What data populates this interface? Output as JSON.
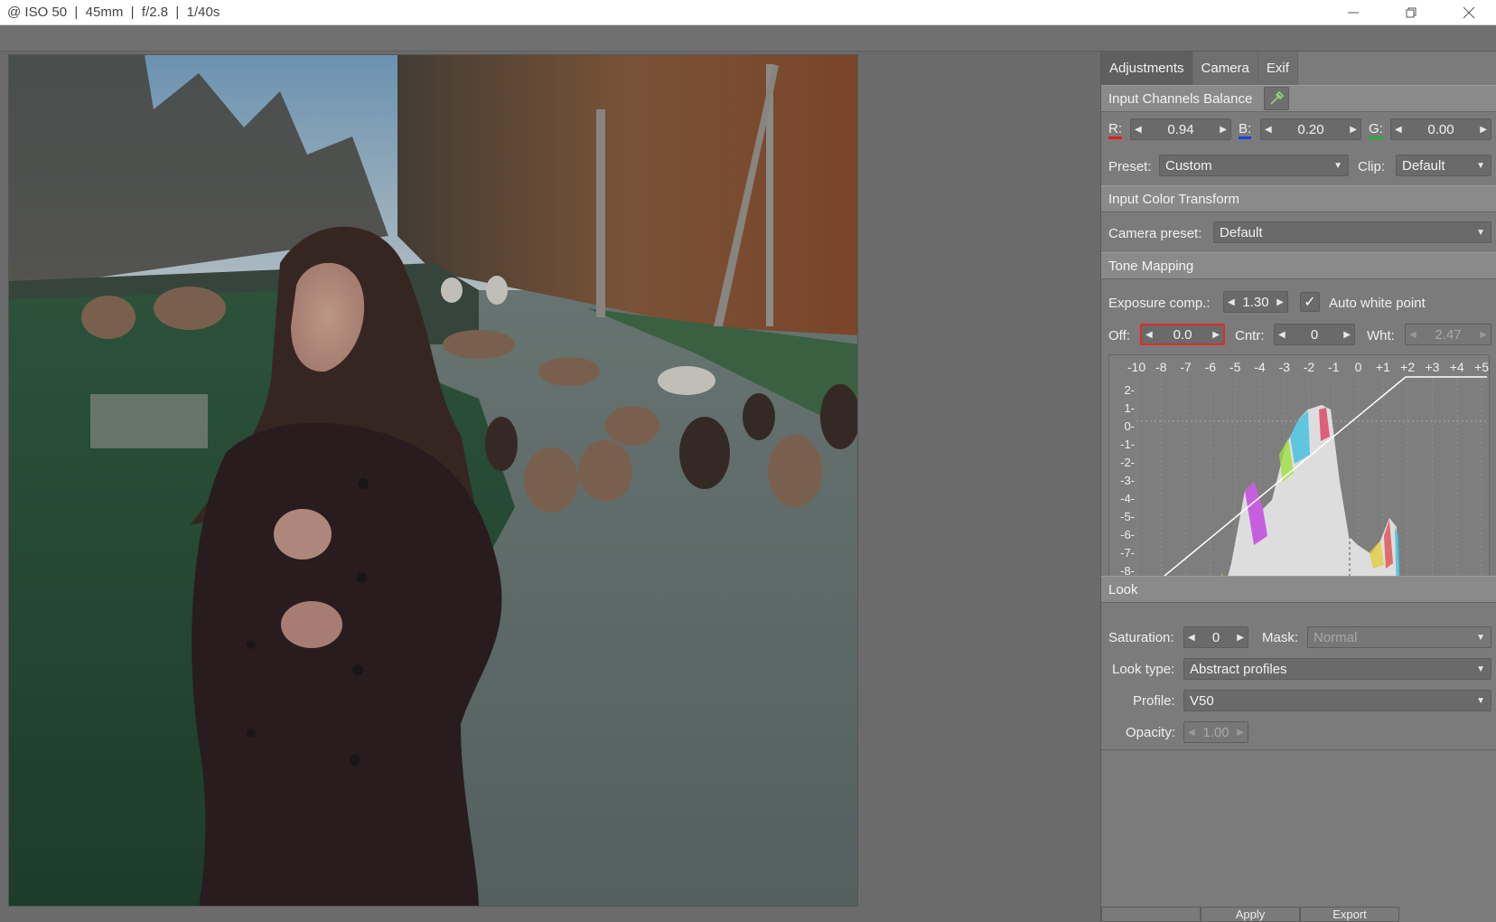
{
  "titlebar": {
    "icon": "@",
    "title": "ISO 50  |  45mm  |  f/2.8  |  1/40s",
    "minimize_icon": "minimize-icon",
    "maximize_icon": "restore-icon",
    "close_icon": "close-icon"
  },
  "panel": {
    "tabs": [
      {
        "label": "Adjustments",
        "active": true
      },
      {
        "label": "Camera",
        "active": false
      },
      {
        "label": "Exif",
        "active": false
      }
    ],
    "input_channels": {
      "title": "Input Channels Balance",
      "eyedropper_icon": "eyedropper-icon",
      "r_label": "R:",
      "r_value": "0.94",
      "b_label": "B:",
      "b_value": "0.20",
      "g_label": "G:",
      "g_value": "0.00",
      "preset_label": "Preset:",
      "preset_value": "Custom",
      "clip_label": "Clip:",
      "clip_value": "Default"
    },
    "input_color_transform": {
      "title": "Input Color Transform",
      "camera_preset_label": "Camera preset:",
      "camera_preset_value": "Default"
    },
    "tone_mapping": {
      "title": "Tone Mapping",
      "exposure_label": "Exposure comp.:",
      "exposure_value": "1.30",
      "auto_white_label": "Auto white point",
      "auto_white_checked": true,
      "off_label": "Off:",
      "off_value": "0.0",
      "cntr_label": "Cntr:",
      "cntr_value": "0",
      "wht_label": "Wht:",
      "wht_value": "2.47",
      "histogram": {
        "x_ticks": [
          "-10",
          "-8",
          "-7",
          "-6",
          "-5",
          "-4",
          "-3",
          "-2",
          "-1",
          "0",
          "+1",
          "+2",
          "+3",
          "+4",
          "+5"
        ],
        "y_ticks": [
          "2-",
          "1-",
          "0-",
          "-1-",
          "-2-",
          "-3-",
          "-4-",
          "-5-",
          "-6-",
          "-7-",
          "-8-",
          "-"
        ]
      }
    },
    "look": {
      "title": "Look",
      "saturation_label": "Saturation:",
      "saturation_value": "0",
      "mask_label": "Mask:",
      "mask_value": "Normal",
      "look_type_label": "Look type:",
      "look_type_value": "Abstract profiles",
      "profile_label": "Profile:",
      "profile_value": "V50",
      "opacity_label": "Opacity:",
      "opacity_value": "1.00"
    },
    "bottom_buttons": [
      "",
      "Apply",
      "Export"
    ]
  },
  "colors": {
    "accent_red": "#e02020",
    "accent_blue": "#2040e0",
    "accent_green": "#20b040",
    "focus_border": "#e02a2a"
  }
}
